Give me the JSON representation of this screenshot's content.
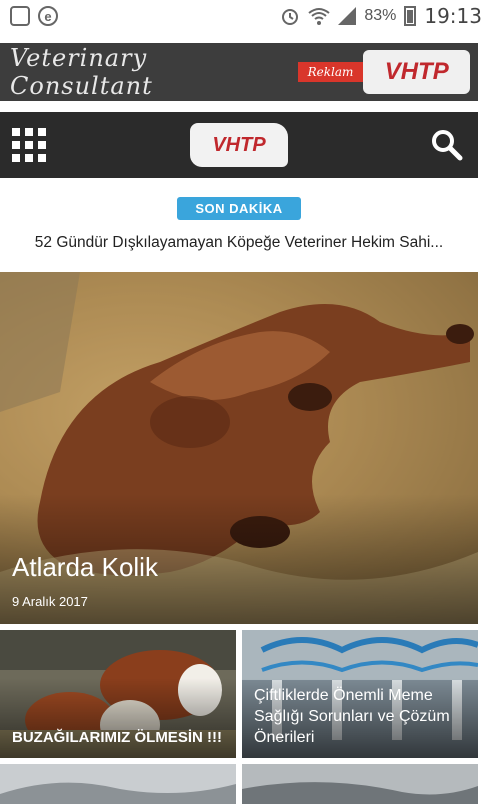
{
  "status_bar": {
    "battery": "83%",
    "time": "19:13",
    "icons": [
      "image-icon",
      "e-app-icon",
      "alarm-icon",
      "wifi-icon",
      "signal-icon",
      "battery-icon"
    ]
  },
  "ad_banner": {
    "text": "Veterinary Consultant",
    "badge": "Reklam",
    "logo": "VHTP"
  },
  "navbar": {
    "menu_icon": "grid-menu-icon",
    "logo": "VHTP",
    "search_icon": "search-icon"
  },
  "breaking": {
    "badge": "SON DAKİKA",
    "headline": "52 Gündür Dışkılayamayan Köpeğe Veteriner Hekim Sahi..."
  },
  "featured": {
    "title": "Atlarda Kolik",
    "date": "9 Aralık 2017"
  },
  "cards": [
    {
      "title": "BUZAĞILARIMIZ ÖLMESİN !!!"
    },
    {
      "title": "Çiftliklerde Önemli Meme Sağlığı Sorunları ve Çözüm Önerileri"
    }
  ],
  "colors": {
    "navbar_bg": "#2b2b2b",
    "ad_bg": "#3d3d3d",
    "badge_bg": "#3aa5dc",
    "ad_badge_bg": "#d9362b",
    "logo_red": "#c0282d"
  }
}
